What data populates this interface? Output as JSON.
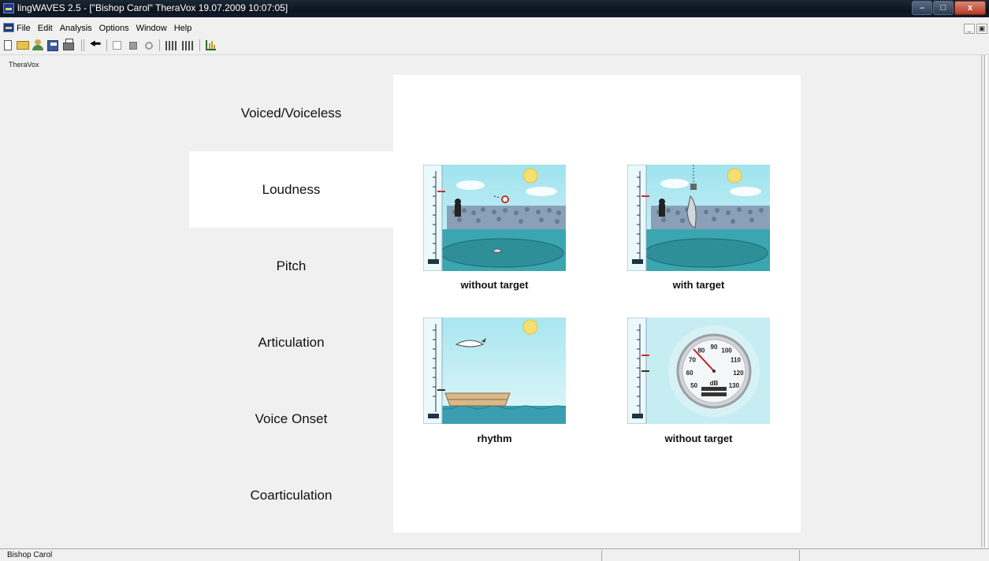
{
  "window": {
    "title": "lingWAVES 2.5 - [\"Bishop Carol\" TheraVox  19.07.2009 10:07:05]"
  },
  "menu": [
    "File",
    "Edit",
    "Analysis",
    "Options",
    "Window",
    "Help"
  ],
  "toolbar": {
    "icons": [
      "new-icon",
      "open-icon",
      "patient-icon",
      "save-icon",
      "print-icon",
      "back-arrow-icon",
      "frame-icon",
      "stop-icon",
      "record-icon",
      "digits-icon",
      "digits-edit-icon",
      "chart-icon"
    ]
  },
  "child_window": {
    "caption": "TheraVox"
  },
  "nav": {
    "items": [
      {
        "label": "Voiced/Voiceless",
        "active": false
      },
      {
        "label": "Loudness",
        "active": true
      },
      {
        "label": "Pitch",
        "active": false
      },
      {
        "label": "Articulation",
        "active": false
      },
      {
        "label": "Voice Onset",
        "active": false
      },
      {
        "label": "Coarticulation",
        "active": false
      }
    ]
  },
  "exercises": [
    {
      "label": "without target",
      "scene": "dolphin-pool-ball"
    },
    {
      "label": "with target",
      "scene": "dolphin-pool-hoop"
    },
    {
      "label": "rhythm",
      "scene": "dolphin-boat"
    },
    {
      "label": "without target",
      "scene": "db-meter"
    }
  ],
  "meter": {
    "dial_labels": [
      "50",
      "60",
      "70",
      "80",
      "90",
      "100",
      "110",
      "120",
      "130"
    ],
    "unit": "dB"
  },
  "statusbar": {
    "text": "Bishop Carol"
  }
}
